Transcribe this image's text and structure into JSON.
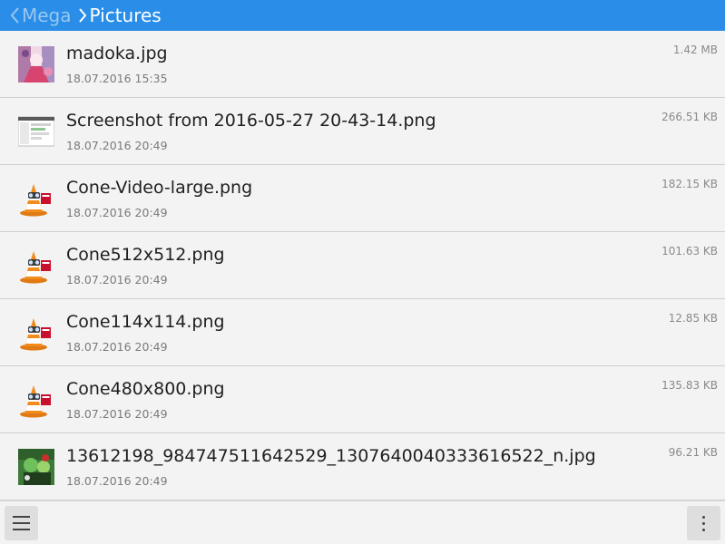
{
  "header": {
    "breadcrumbs": [
      {
        "label": "Mega",
        "color": "#98c6f1"
      },
      {
        "label": "Pictures",
        "color": "#ffffff"
      }
    ],
    "background": "#2a8ee8"
  },
  "files": [
    {
      "name": "madoka.jpg",
      "date": "18.07.2016 15:35",
      "size": "1.42 MB",
      "icon": "anime-photo-thumbnail"
    },
    {
      "name": "Screenshot from 2016-05-27 20-43-14.png",
      "date": "18.07.2016 20:49",
      "size": "266.51 KB",
      "icon": "screenshot-thumbnail"
    },
    {
      "name": "Cone-Video-large.png",
      "date": "18.07.2016 20:49",
      "size": "182.15 KB",
      "icon": "vlc-cone-thumbnail"
    },
    {
      "name": "Cone512x512.png",
      "date": "18.07.2016 20:49",
      "size": "101.63 KB",
      "icon": "vlc-cone-thumbnail"
    },
    {
      "name": "Cone114x114.png",
      "date": "18.07.2016 20:49",
      "size": "12.85 KB",
      "icon": "vlc-cone-thumbnail"
    },
    {
      "name": "Cone480x800.png",
      "date": "18.07.2016 20:49",
      "size": "135.83 KB",
      "icon": "vlc-cone-thumbnail"
    },
    {
      "name": "13612198_984747511642529_1307640040333616522_n.jpg",
      "date": "18.07.2016 20:49",
      "size": "96.21 KB",
      "icon": "green-photo-thumbnail"
    }
  ],
  "footer": {
    "menu_icon": "hamburger-menu-icon",
    "more_icon": "vertical-dots-icon"
  }
}
